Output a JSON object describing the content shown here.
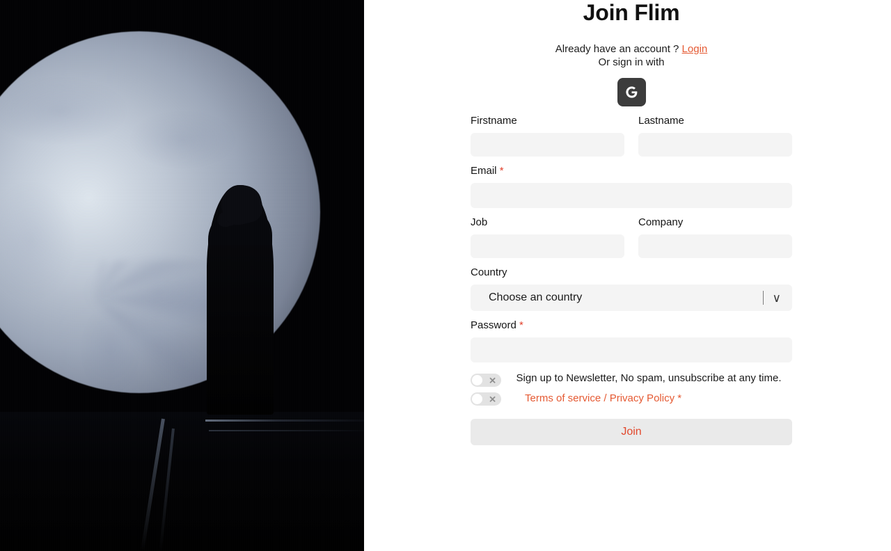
{
  "hero": {
    "alt_description": "Silhouette of a figure standing on a dark ledge in front of a large pale blue moon"
  },
  "header": {
    "title": "Join Flim",
    "account_prompt": "Already have an account ?",
    "login_label": "Login",
    "or_sign_in_with": "Or sign in with",
    "google_icon": "google-g-icon"
  },
  "form": {
    "fields": [
      {
        "label": "Firstname",
        "required": false,
        "value": "",
        "placeholder": "",
        "name": "firstname"
      },
      {
        "label": "Lastname",
        "required": false,
        "value": "",
        "placeholder": "",
        "name": "lastname"
      },
      {
        "label": "Email",
        "required": true,
        "value": "",
        "placeholder": "",
        "name": "email"
      },
      {
        "label": "Job",
        "required": false,
        "value": "",
        "placeholder": "",
        "name": "job"
      },
      {
        "label": "Company",
        "required": false,
        "value": "",
        "placeholder": "",
        "name": "company"
      },
      {
        "label": "Password",
        "required": true,
        "value": "",
        "placeholder": "",
        "name": "password"
      }
    ],
    "required_marker": "*",
    "country": {
      "label": "Country",
      "selected": "Choose an country",
      "caret_icon": "chevron-down-icon"
    },
    "newsletter": {
      "text": "Sign up to Newsletter, No spam, unsubscribe at any time.",
      "state": "off",
      "knob_icon": "toggle-off-x-icon"
    },
    "legal": {
      "terms_label": "Terms of service",
      "separator": "/",
      "privacy_label": "Privacy Policy",
      "required_marker": "*",
      "state": "off",
      "knob_icon": "toggle-off-x-icon"
    },
    "submit_label": "Join"
  },
  "colors": {
    "accent": "#e55a33",
    "accent_button_text": "#e2482c",
    "required_star": "#e2412c",
    "field_background": "#f4f4f4",
    "button_background": "#eaeaea",
    "google_button": "#3c3c3c",
    "text": "#141414",
    "toggle_track": "#e2e2e2",
    "toggle_knob": "#ffffff"
  }
}
